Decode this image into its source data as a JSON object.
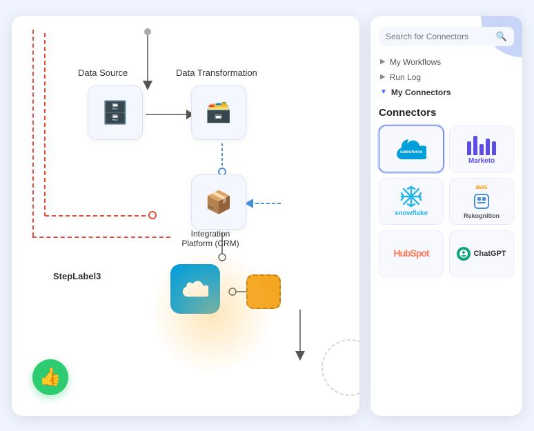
{
  "canvas": {
    "label_datasource": "Data Source",
    "label_transform": "Data Transformation",
    "label_crm": "Integration\nPlatform (CRM)",
    "label_steplabel": "StepLabel3",
    "thumbs_up": "👍"
  },
  "panel": {
    "search_placeholder": "Search for Connectors",
    "nav_items": [
      {
        "label": "My Workflows",
        "expanded": false
      },
      {
        "label": "Run Log",
        "expanded": false
      },
      {
        "label": "My Connectors",
        "expanded": true
      }
    ],
    "connectors_title": "Connectors",
    "connectors": [
      {
        "id": "salesforce",
        "name": "salesforce",
        "selected": true
      },
      {
        "id": "marketo",
        "name": "Marketo",
        "selected": false
      },
      {
        "id": "snowflake",
        "name": "snowflake",
        "selected": false
      },
      {
        "id": "rekognition",
        "name": "Rekognition",
        "selected": false
      },
      {
        "id": "hubspot",
        "name": "HubSpot",
        "selected": false
      },
      {
        "id": "chatgpt",
        "name": "ChatGPT",
        "selected": false
      }
    ]
  }
}
